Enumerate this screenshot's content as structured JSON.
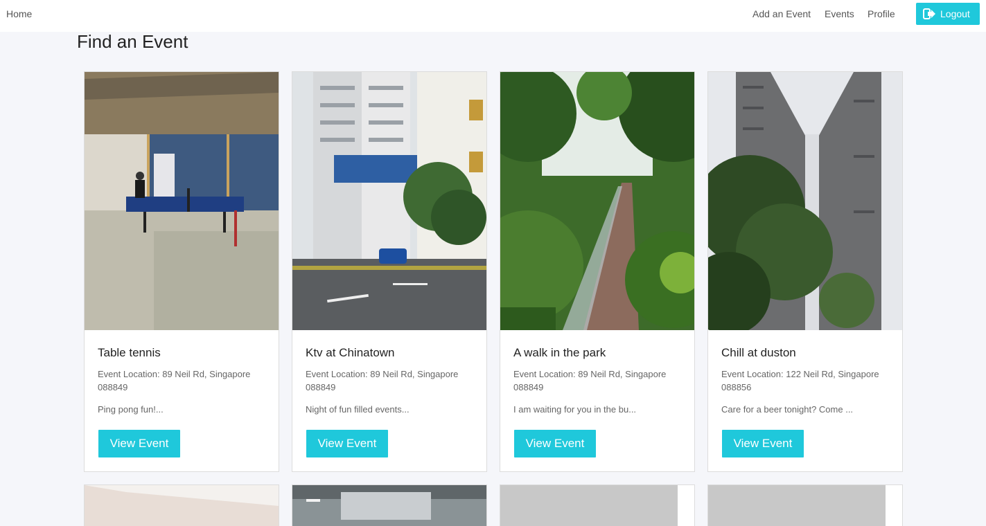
{
  "nav": {
    "home": "Home",
    "add_event": "Add an Event",
    "events": "Events",
    "profile": "Profile",
    "logout": "Logout",
    "logout_icon": "sign-out-icon",
    "accent": "#1fc8db"
  },
  "page": {
    "title": "Find an Event"
  },
  "events": [
    {
      "title": "Table tennis",
      "location": "Event Location: 89 Neil Rd, Singapore 088849",
      "description": "Ping pong fun!...",
      "button": "View Event",
      "image": "ping-pong-room-photo"
    },
    {
      "title": "Ktv at Chinatown",
      "location": "Event Location: 89 Neil Rd, Singapore 088849",
      "description": "Night of fun filled events...",
      "button": "View Event",
      "image": "chinatown-street-photo"
    },
    {
      "title": "A walk in the park",
      "location": "Event Location: 89 Neil Rd, Singapore 088849",
      "description": "I am waiting for you in the bu...",
      "button": "View Event",
      "image": "park-walkway-photo"
    },
    {
      "title": "Chill at duston",
      "location": "Event Location: 122 Neil Rd, Singapore 088856",
      "description": "Care for a beer tonight? Come ...",
      "button": "View Event",
      "image": "tower-block-photo"
    }
  ]
}
